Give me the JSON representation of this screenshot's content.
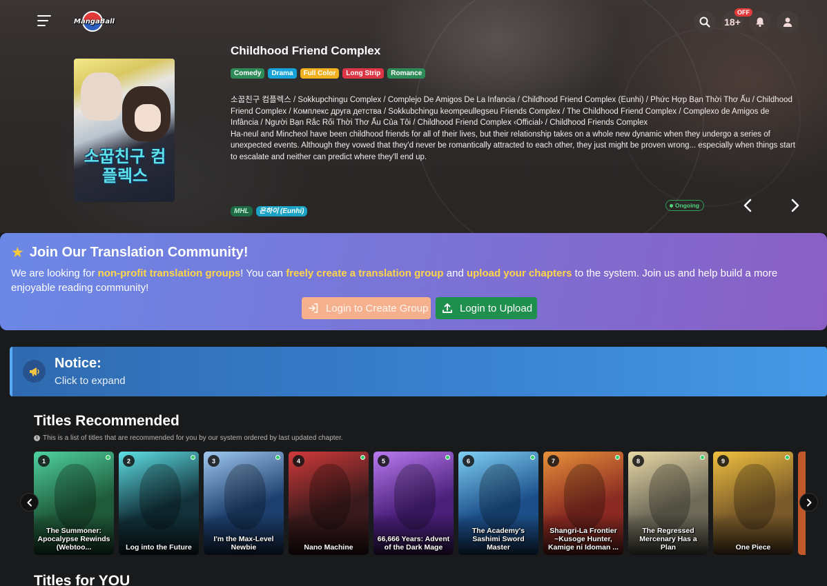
{
  "header": {
    "logo_text": "MangaBall",
    "age_label": "18+",
    "off_badge": "OFF"
  },
  "hero": {
    "title": "Childhood Friend Complex",
    "tags": [
      {
        "label": "Comedy",
        "color": "#2e8b57"
      },
      {
        "label": "Drama",
        "color": "#17a2d8"
      },
      {
        "label": "Full Color",
        "color": "#f0b020"
      },
      {
        "label": "Long Strip",
        "color": "#dc3545"
      },
      {
        "label": "Romance",
        "color": "#2e8b57"
      }
    ],
    "alt_titles": "소꿉친구 컴플렉스 / Sokkupchingu Complex / Complejo De Amigos De La Infancia / Childhood Friend Complex (Eunhi) / Phức Hợp Bạn Thời Thơ Ấu / Childhood Friend Complex / Комплекс друга детства / Sokkubchingu keompeullegseu Friends Complex / The Childhood Friend Complex / Complexo de Amigos de Infância / Người Bạn Rắc Rối Thời Thơ Ấu Của Tôi / Childhood Friend Complex ‹Official› / Childhood Friends Complex",
    "description": "Ha-neul and Mincheol have been childhood friends for all of their lives, but their relationship takes on a whole new dynamic when they undergo a series of unexpected events. Although they vowed that they'd never be romantically attracted to each other, they just might be proven wrong... especially when things start to escalate and neither can predict where they'll end up.",
    "cover_text": "소꿉친구 컴플렉스",
    "people": [
      {
        "label": "MHL",
        "bg": "#1f6b45",
        "fg": "#bff0d2"
      },
      {
        "label": "은하이 (Eunhi)",
        "bg": "#1aa3c4",
        "fg": "#ffffff"
      }
    ],
    "status": "Ongoing"
  },
  "community": {
    "title": "Join Our Translation Community!",
    "text_1": "We are looking for ",
    "hl_1": "non-profit translation groups",
    "text_2": "! You can ",
    "hl_2": "freely create a translation group",
    "text_3": " and ",
    "hl_3": "upload your chapters",
    "text_4": " to the system. Join us and help build a more enjoyable reading community!",
    "btn_create": "Login to Create Group",
    "btn_upload": "Login to Upload"
  },
  "notice": {
    "title": "Notice:",
    "subtitle": "Click to expand"
  },
  "recommended": {
    "title": "Titles Recommended",
    "note": "This is a list of titles that are recommended for you by our system ordered by last updated chapter.",
    "items": [
      {
        "rank": "1",
        "title": "The Summoner: Apocalypse Rewinds (Webtoo...",
        "bg": "#1f5a3a",
        "accent": "#4fd2a0"
      },
      {
        "rank": "2",
        "title": "Log into the Future",
        "bg": "#12313a",
        "accent": "#5fe0e6"
      },
      {
        "rank": "3",
        "title": "I'm the Max-Level Newbie",
        "bg": "#1d3f6e",
        "accent": "#9fc8ef"
      },
      {
        "rank": "4",
        "title": "Nano Machine",
        "bg": "#3a1a1c",
        "accent": "#d23a3a"
      },
      {
        "rank": "5",
        "title": "66,666 Years: Advent of the Dark Mage",
        "bg": "#4a1f7a",
        "accent": "#b97af0"
      },
      {
        "rank": "6",
        "title": "The Academy's Sashimi Sword Master",
        "bg": "#1c4f8a",
        "accent": "#7fd0f5"
      },
      {
        "rank": "7",
        "title": "Shangri-La Frontier ~Kusoge Hunter, Kamige ni Idoman ...",
        "bg": "#8a2a22",
        "accent": "#e8913a"
      },
      {
        "rank": "8",
        "title": "The Regressed Mercenary Has a Plan",
        "bg": "#6e6a5a",
        "accent": "#e9d9a6"
      },
      {
        "rank": "9",
        "title": "One Piece",
        "bg": "#7a5a2a",
        "accent": "#f0c040"
      }
    ]
  },
  "for_you": {
    "title": "Titles for YOU"
  }
}
